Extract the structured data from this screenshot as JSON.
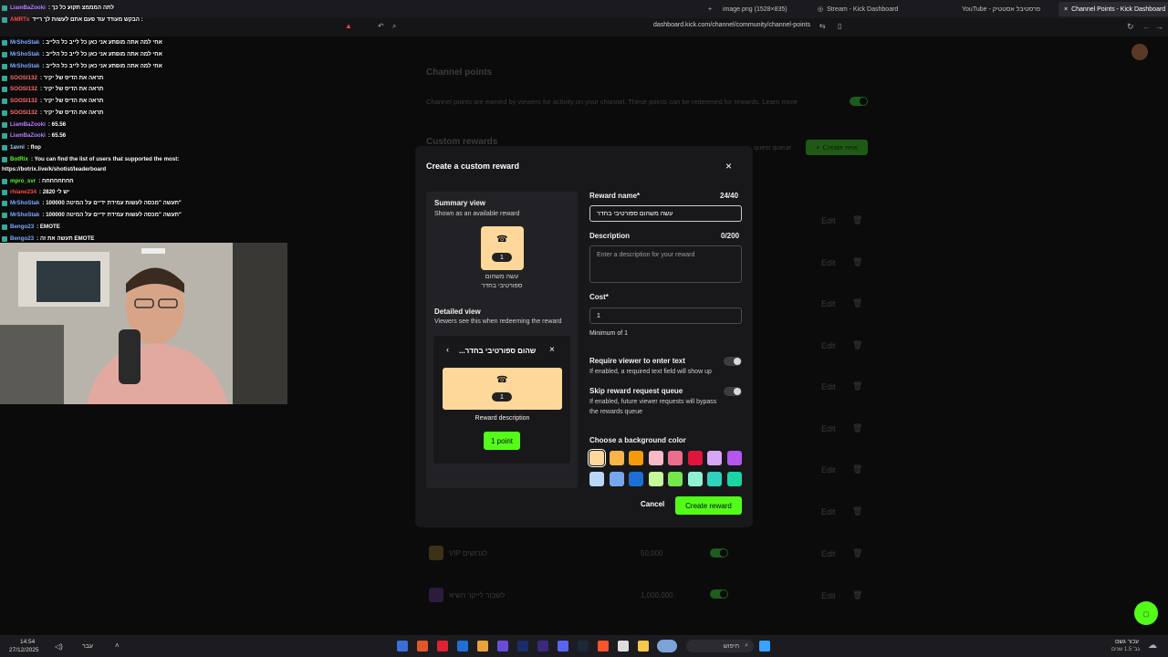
{
  "browser": {
    "tabs": [
      {
        "label": "image.png (1528×835)"
      },
      {
        "label": "Stream - Kick Dashboard"
      },
      {
        "label": "YouTube - פרסטיבל אסטטיק"
      },
      {
        "label": "Channel Points - Kick Dashboard"
      }
    ],
    "url": "dashboard.kick.com/channel/community/channel-points"
  },
  "chat": {
    "lines": [
      {
        "user": "LiamBaZooki",
        "message": ": לתה המממצ תקוע כל כך",
        "color": "#b57cff"
      },
      {
        "user": "AMRTx",
        "message": "הבקש מעודד עוד פעם אתם לעשות לך רייד :",
        "color": "#ff4a4a"
      },
      {
        "user": "MrShoStak",
        "message": ": אחי למה אתה מופתע אני כאן כל לייב כל הלייב",
        "color": "#7aa8ff"
      },
      {
        "user": "MrShoStak",
        "message": ": אחי למה אתה מופתע אני כאן כל לייב כל הלייב",
        "color": "#7aa8ff"
      },
      {
        "user": "MrShoStak",
        "message": ": אחי למה אתה מופתע אני כאן כל לייב כל הלייב",
        "color": "#7aa8ff"
      },
      {
        "user": "SOOSI132",
        "message": ": תראה את הדיס של יקיר",
        "color": "#ff6a6a"
      },
      {
        "user": "SOOSI132",
        "message": ": תראה את הדיס של יקיר",
        "color": "#ff6a6a"
      },
      {
        "user": "SOOSI132",
        "message": ": תראה את הדיס של יקיר",
        "color": "#ff6a6a"
      },
      {
        "user": "SOOSI132",
        "message": ": תראה את הדיס של יקיר",
        "color": "#ff6a6a"
      },
      {
        "user": "LiamBaZooki",
        "message": ": 65.56",
        "color": "#b57cff"
      },
      {
        "user": "LiamBaZooki",
        "message": ": 65.56",
        "color": "#b57cff"
      },
      {
        "user": "1avni",
        "message": ": flop",
        "color": "#9ad0ff"
      },
      {
        "user": "BotRix",
        "message": ": You can find the list of users that supported the most:",
        "color": "#53fc18"
      },
      {
        "user": "",
        "message": "https://botrix.live/k/shotist/leaderboard",
        "color": "#ffffff"
      },
      {
        "user": "mpro_svr",
        "message": ": חחחחחחחח",
        "color": "#53fc18"
      },
      {
        "user": "rhiane234",
        "message": ": יש לי 2820",
        "color": "#ff4a4a"
      },
      {
        "user": "MrShoStak",
        "message": ": 100000 תעשה \"מכסה לעשות עמידת ידיים על המיטה\"",
        "color": "#7aa8ff"
      },
      {
        "user": "MrShoStak",
        "message": ": 100000 תעשה \"מכסה לעשות עמידת ידיים על המיטה\"",
        "color": "#7aa8ff"
      },
      {
        "user": "Bengo23",
        "message": ": EMOTE",
        "color": "#7aa8ff"
      },
      {
        "user": "Bengo23",
        "message": ": תעשה את זה EMOTE",
        "color": "#7aa8ff"
      }
    ]
  },
  "background_page": {
    "title": "Channel points",
    "description": "Channel points are earned by viewers for activity on your channel. These points can be redeemed for rewards. Learn more",
    "custom_rewards_title": "Custom rewards",
    "request_queue_label": "quest queue",
    "create_new_label": "Create new",
    "edit_label": "Edit",
    "rows": [
      {
        "name": "VIP לגרושים",
        "cost": "50,000"
      },
      {
        "name": "לשבור לייקר חשיא",
        "cost": "1,000,000"
      }
    ]
  },
  "modal": {
    "title": "Create a custom reward",
    "close_icon": "×",
    "summary": {
      "title": "Summary view",
      "subtitle": "Shown as an available reward",
      "reward_cost": "1",
      "reward_name_line1": "עשה משהום",
      "reward_name_line2": "ספורטיבי בחדר",
      "card_color": "#fdd89a"
    },
    "detailed": {
      "title": "Detailed view",
      "subtitle": "Viewers see this when redeeming the reward",
      "header_name": "...שהום ספורטיבי בחדר",
      "reward_cost": "1",
      "reward_description": "Reward description",
      "points_button": "1 point"
    },
    "form": {
      "reward_name_label": "Reward name*",
      "reward_name_count": "24/40",
      "reward_name_value": "עשה משהום ספורטיבי בחדר",
      "description_label": "Description",
      "description_count": "0/200",
      "description_placeholder": "Enter a description for your reward",
      "cost_label": "Cost*",
      "cost_value": "1",
      "cost_hint": "Minimum of 1",
      "require_text_label": "Require viewer to enter text",
      "require_text_hint": "If enabled, a required text field will show up",
      "require_text_enabled": false,
      "skip_queue_label": "Skip reward request queue",
      "skip_queue_hint_1": "If enabled, future viewer requests will bypass",
      "skip_queue_hint_2": "the rewards queue",
      "skip_queue_enabled": false,
      "color_label": "Choose a background color",
      "colors": [
        "#fdd89a",
        "#f9b44a",
        "#f59a0b",
        "#f8b9c8",
        "#ec6c8c",
        "#e0153c",
        "#d9a5f5",
        "#b456f0",
        "#b9d6f7",
        "#74a7f0",
        "#1f6ed6",
        "#c6f79a",
        "#74e84a",
        "#8ff0d2",
        "#31d1c0",
        "#19d6a2"
      ],
      "selected_color_index": 0
    },
    "cancel_label": "Cancel",
    "create_label": "Create reward"
  },
  "taskbar": {
    "time": "14:54",
    "date": "27/12/2025",
    "lang": "עבר",
    "search_placeholder": "חיפוש",
    "weather_line1": "עכור גשם",
    "weather_line2": "גב' 1.5 שנים"
  }
}
